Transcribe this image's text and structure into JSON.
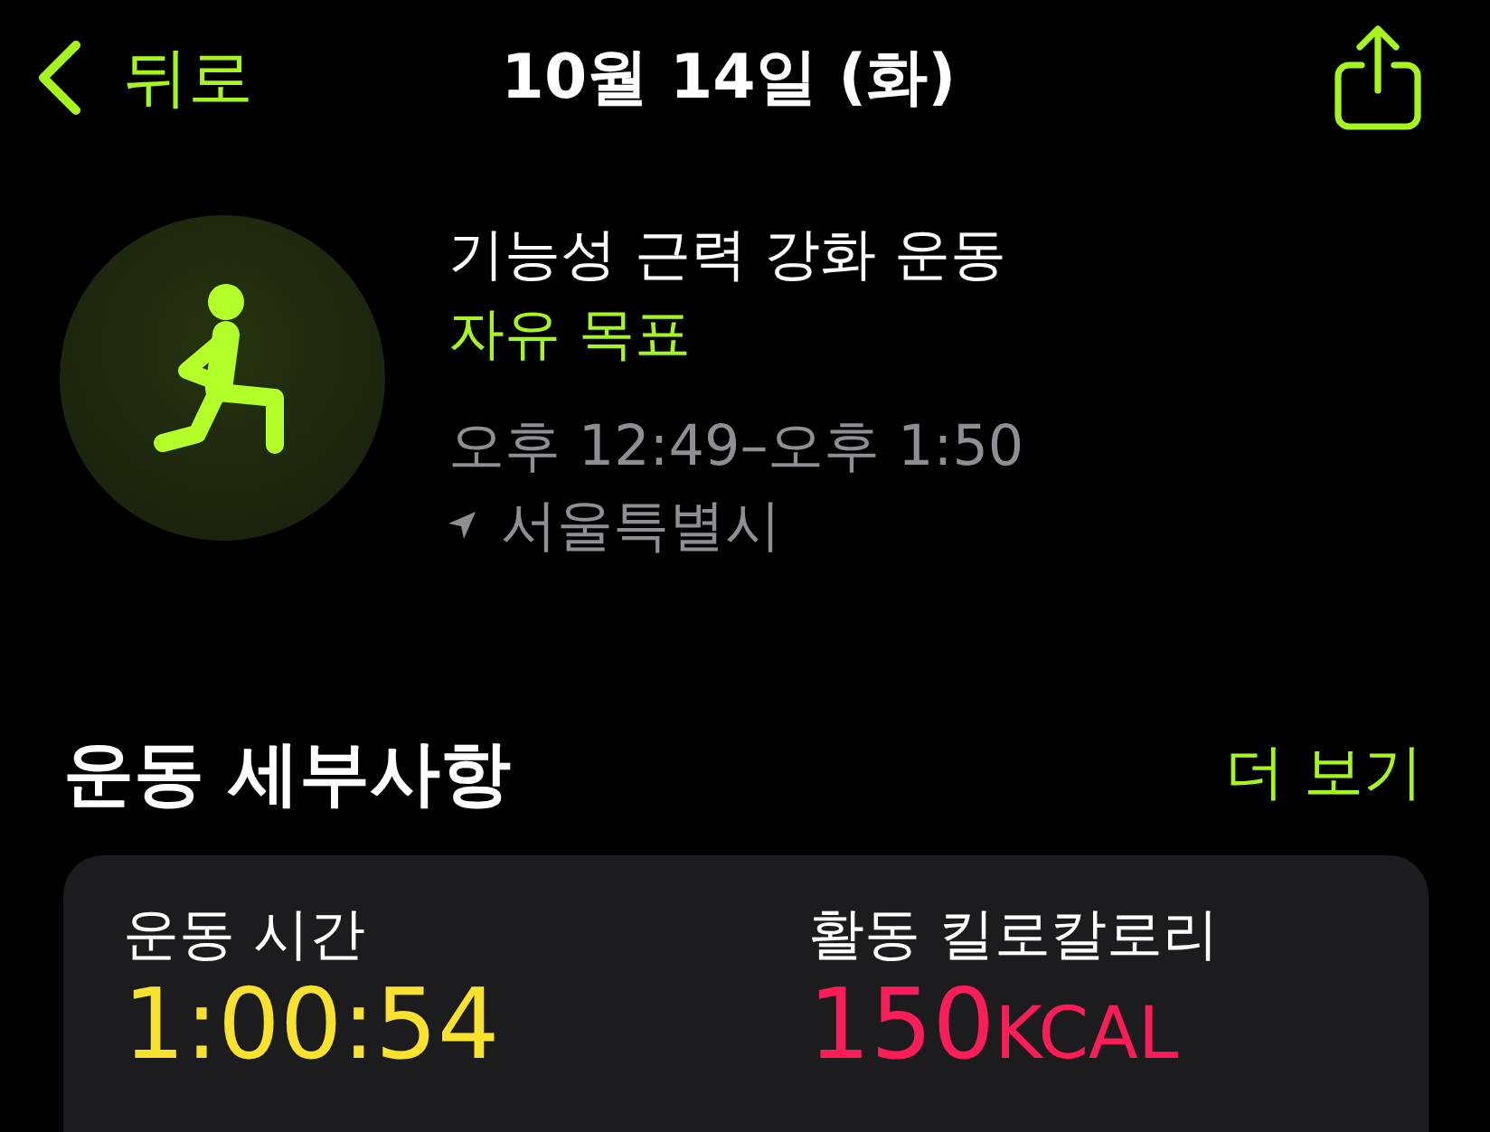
{
  "nav": {
    "back_label": "뒤로",
    "title": "10월 14일 (화)"
  },
  "workout": {
    "name": "기능성 근력 강화 운동",
    "goal": "자유 목표",
    "time_range": "오후 12:49–오후 1:50",
    "location": "서울특별시"
  },
  "details": {
    "heading": "운동 세부사항",
    "more_link": "더 보기",
    "metrics": [
      {
        "label": "운동 시간",
        "value": "1:00:54",
        "color": "#f9e22e"
      },
      {
        "label": "활동 킬로칼로리",
        "value": "150",
        "unit": "KCAL",
        "color": "#fa1d58"
      }
    ]
  }
}
